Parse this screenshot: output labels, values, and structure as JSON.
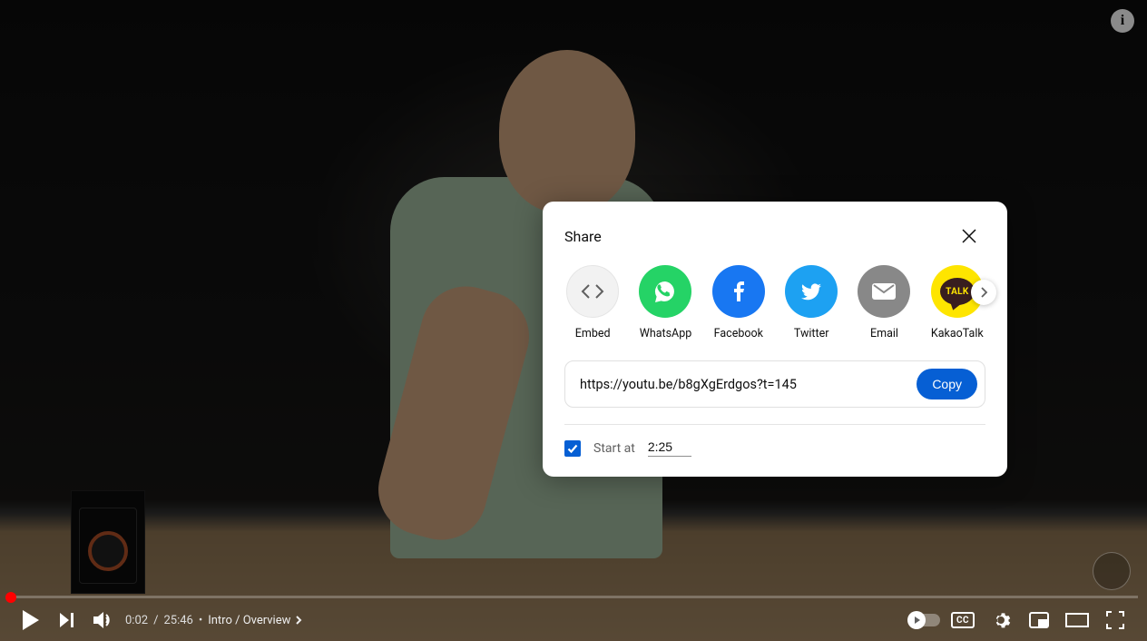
{
  "player": {
    "current_time": "0:02",
    "duration": "25:46",
    "chapter": "Intro / Overview",
    "cc_label": "CC",
    "info_label": "i"
  },
  "dialog": {
    "title": "Share",
    "url": "https://youtu.be/b8gXgErdgos?t=145",
    "copy_label": "Copy",
    "start_at_label": "Start at",
    "start_at_value": "2:25",
    "options": {
      "embed": "Embed",
      "whatsapp": "WhatsApp",
      "facebook": "Facebook",
      "twitter": "Twitter",
      "email": "Email",
      "kakaotalk": "KakaoTalk",
      "kakao_bubble": "TALK"
    }
  }
}
